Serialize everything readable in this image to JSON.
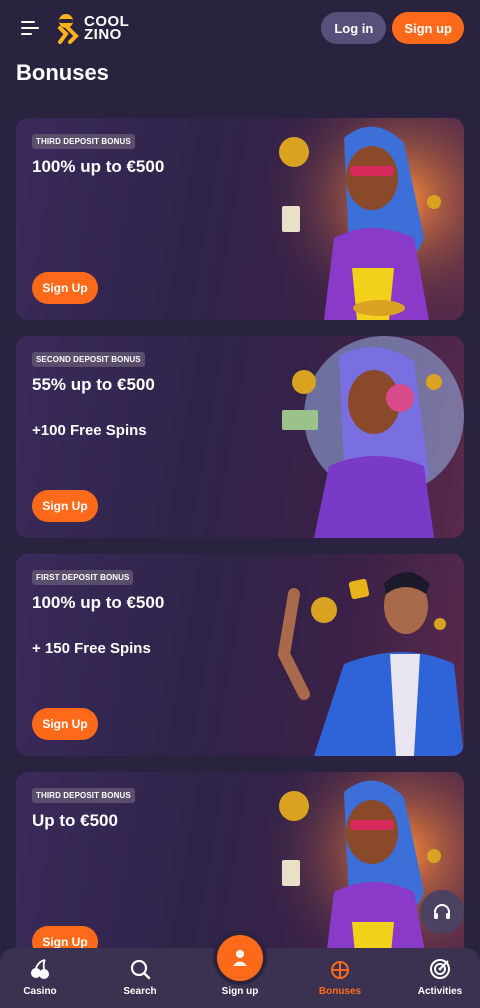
{
  "header": {
    "logo_line1": "COOL",
    "logo_line2": "ZINO",
    "login_label": "Log in",
    "signup_label": "Sign up"
  },
  "page_title": "Bonuses",
  "cards": [
    {
      "tag": "THIRD DEPOSIT BONUS",
      "offer": "100% up to €500",
      "extra": "",
      "button": "Sign Up"
    },
    {
      "tag": "SECOND DEPOSIT BONUS",
      "offer": "55% up to €500",
      "extra": "+100 Free Spins",
      "button": "Sign Up"
    },
    {
      "tag": "FIRST DEPOSIT BONUS",
      "offer": "100% up to €500",
      "extra": "+ 150 Free Spins",
      "button": "Sign Up"
    },
    {
      "tag": "THIRD DEPOSIT BONUS",
      "offer": "Up to €500",
      "extra": "",
      "button": "Sign Up"
    }
  ],
  "nav": {
    "casino": "Casino",
    "search": "Search",
    "signup": "Sign up",
    "bonuses": "Bonuses",
    "activities": "Activities"
  },
  "colors": {
    "background": "#2a2340",
    "accent": "#ff6a1a",
    "login_button": "#58507a",
    "nav_bg": "#3a3250"
  },
  "icons": {
    "menu": "menu-icon",
    "support": "headset-icon",
    "casino": "cherries-icon",
    "search": "search-icon",
    "signup": "user-icon",
    "bonuses": "gift-icon",
    "activities": "target-icon"
  }
}
